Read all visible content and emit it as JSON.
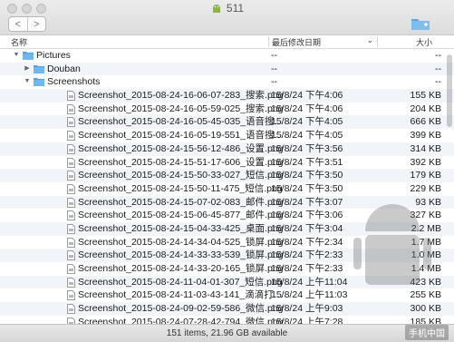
{
  "window": {
    "title": "511"
  },
  "toolbar": {
    "back_glyph": "<",
    "forward_glyph": ">"
  },
  "columns": {
    "name": "名称",
    "date": "最后修改日期",
    "size": "大小"
  },
  "rows": [
    {
      "indent": 0,
      "kind": "folder",
      "disclosure": "open",
      "name": "Pictures",
      "date": "--",
      "size": "--"
    },
    {
      "indent": 1,
      "kind": "folder",
      "disclosure": "closed",
      "name": "Douban",
      "date": "--",
      "size": "--"
    },
    {
      "indent": 1,
      "kind": "folder",
      "disclosure": "open",
      "name": "Screenshots",
      "date": "--",
      "size": "--"
    },
    {
      "indent": 2,
      "kind": "file",
      "name": "Screenshot_2015-08-24-16-06-07-283_搜索.png",
      "date": "15/8/24 下午4:06",
      "size": "155 KB"
    },
    {
      "indent": 2,
      "kind": "file",
      "name": "Screenshot_2015-08-24-16-05-59-025_搜索.png",
      "date": "15/8/24 下午4:06",
      "size": "204 KB"
    },
    {
      "indent": 2,
      "kind": "file",
      "name": "Screenshot_2015-08-24-16-05-45-035_语音搜…",
      "date": "15/8/24 下午4:05",
      "size": "666 KB"
    },
    {
      "indent": 2,
      "kind": "file",
      "name": "Screenshot_2015-08-24-16-05-19-551_语音搜…",
      "date": "15/8/24 下午4:05",
      "size": "399 KB"
    },
    {
      "indent": 2,
      "kind": "file",
      "name": "Screenshot_2015-08-24-15-56-12-486_设置.png",
      "date": "15/8/24 下午3:56",
      "size": "314 KB"
    },
    {
      "indent": 2,
      "kind": "file",
      "name": "Screenshot_2015-08-24-15-51-17-606_设置.png",
      "date": "15/8/24 下午3:51",
      "size": "392 KB"
    },
    {
      "indent": 2,
      "kind": "file",
      "name": "Screenshot_2015-08-24-15-50-33-027_短信.png",
      "date": "15/8/24 下午3:50",
      "size": "179 KB"
    },
    {
      "indent": 2,
      "kind": "file",
      "name": "Screenshot_2015-08-24-15-50-11-475_短信.png",
      "date": "15/8/24 下午3:50",
      "size": "229 KB"
    },
    {
      "indent": 2,
      "kind": "file",
      "name": "Screenshot_2015-08-24-15-07-02-083_邮件.png",
      "date": "15/8/24 下午3:07",
      "size": "93 KB"
    },
    {
      "indent": 2,
      "kind": "file",
      "name": "Screenshot_2015-08-24-15-06-45-877_邮件.png",
      "date": "15/8/24 下午3:06",
      "size": "327 KB"
    },
    {
      "indent": 2,
      "kind": "file",
      "name": "Screenshot_2015-08-24-15-04-33-425_桌面.png",
      "date": "15/8/24 下午3:04",
      "size": "2.2 MB"
    },
    {
      "indent": 2,
      "kind": "file",
      "name": "Screenshot_2015-08-24-14-34-04-525_锁屏.png",
      "date": "15/8/24 下午2:34",
      "size": "1.7 MB"
    },
    {
      "indent": 2,
      "kind": "file",
      "name": "Screenshot_2015-08-24-14-33-33-539_锁屏.png",
      "date": "15/8/24 下午2:33",
      "size": "1.0 MB"
    },
    {
      "indent": 2,
      "kind": "file",
      "name": "Screenshot_2015-08-24-14-33-20-165_锁屏.png",
      "date": "15/8/24 下午2:33",
      "size": "1.4 MB"
    },
    {
      "indent": 2,
      "kind": "file",
      "name": "Screenshot_2015-08-24-11-04-01-307_短信.png",
      "date": "15/8/24 上午11:04",
      "size": "423 KB"
    },
    {
      "indent": 2,
      "kind": "file",
      "name": "Screenshot_2015-08-24-11-03-43-141_滴滴打…",
      "date": "15/8/24 上午11:03",
      "size": "255 KB"
    },
    {
      "indent": 2,
      "kind": "file",
      "name": "Screenshot_2015-08-24-09-02-59-586_微信.png",
      "date": "15/8/24 上午9:03",
      "size": "300 KB"
    },
    {
      "indent": 2,
      "kind": "file",
      "name": "Screenshot_2015-08-24-07-28-42-794_微信.png",
      "date": "15/8/24 上午7:28",
      "size": "185 KB"
    }
  ],
  "status": {
    "text": "151 items, 21.96 GB available"
  },
  "watermark": {
    "text": "手机中国"
  },
  "colors": {
    "folder": "#4aa3e8",
    "alt_row": "#f1f5fa"
  }
}
